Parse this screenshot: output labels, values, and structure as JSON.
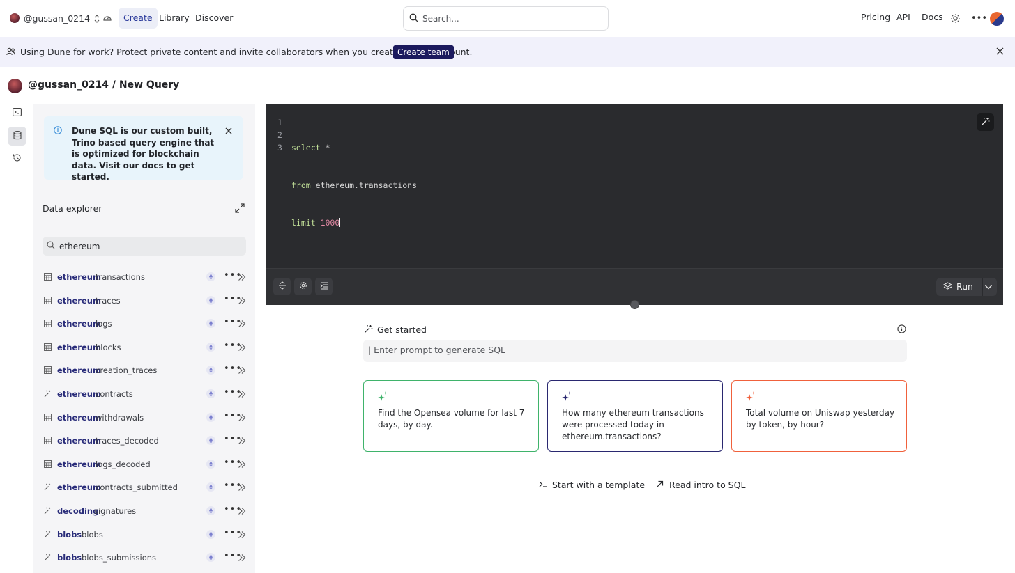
{
  "nav": {
    "username": "@gussan_0214",
    "links": [
      "Create",
      "Library",
      "Discover"
    ],
    "search_placeholder": "Search...",
    "right_links": [
      "Pricing",
      "API",
      "Docs"
    ]
  },
  "banner": {
    "text": "Using Dune for work? Protect private content and invite collaborators when you create a team account.",
    "button": "Create team"
  },
  "page": {
    "title": "@gussan_0214 / New Query"
  },
  "sidebar": {
    "info_text": "Dune SQL is our custom built, Trino based query engine that is optimized for blockchain data. Visit our docs to get started.",
    "data_explorer_title": "Data explorer",
    "search_value": "ethereum",
    "tables": [
      {
        "schema": "ethereum",
        "name": "transactions",
        "icon": "table-icon"
      },
      {
        "schema": "ethereum",
        "name": "traces",
        "icon": "table-icon"
      },
      {
        "schema": "ethereum",
        "name": "logs",
        "icon": "table-icon"
      },
      {
        "schema": "ethereum",
        "name": "blocks",
        "icon": "table-icon"
      },
      {
        "schema": "ethereum",
        "name": "creation_traces",
        "icon": "table-icon"
      },
      {
        "schema": "ethereum",
        "name": "contracts",
        "icon": "wand-icon"
      },
      {
        "schema": "ethereum",
        "name": "withdrawals",
        "icon": "table-icon"
      },
      {
        "schema": "ethereum",
        "name": "traces_decoded",
        "icon": "table-icon"
      },
      {
        "schema": "ethereum",
        "name": "logs_decoded",
        "icon": "table-icon"
      },
      {
        "schema": "ethereum",
        "name": "contracts_submitted",
        "icon": "wand-icon"
      },
      {
        "schema": "decoding",
        "name": "signatures",
        "icon": "wand-icon"
      },
      {
        "schema": "blobs",
        "name": "blobs",
        "icon": "wand-icon"
      },
      {
        "schema": "blobs",
        "name": "blobs_submissions",
        "icon": "wand-icon"
      }
    ]
  },
  "editor": {
    "line_numbers": [
      "1",
      "2",
      "3"
    ],
    "line1_kw": "select",
    "line1_rest": " *",
    "line2_kw": "from",
    "line2_rest": " ethereum.transactions",
    "line3_kw": "limit",
    "line3_num": "1000",
    "run_label": "Run"
  },
  "get_started": {
    "title": "Get started",
    "prompt_placeholder": "| Enter prompt to generate SQL",
    "cards": [
      {
        "text": "Find the Opensea volume for last 7 days, by day.",
        "color": "#3fb36b"
      },
      {
        "text": "How many ethereum transactions were processed today in ethereum.transactions?",
        "color": "#2a2870"
      },
      {
        "text": "Total volume on Uniswap yesterday by token, by hour?",
        "color": "#f0613c"
      }
    ],
    "links": [
      "Start with a template",
      "Read intro to SQL"
    ]
  },
  "colors": {
    "accent": "#1c1a5e",
    "banner_bg": "#f1f1fb",
    "editor_bg": "#2a2b2e"
  }
}
